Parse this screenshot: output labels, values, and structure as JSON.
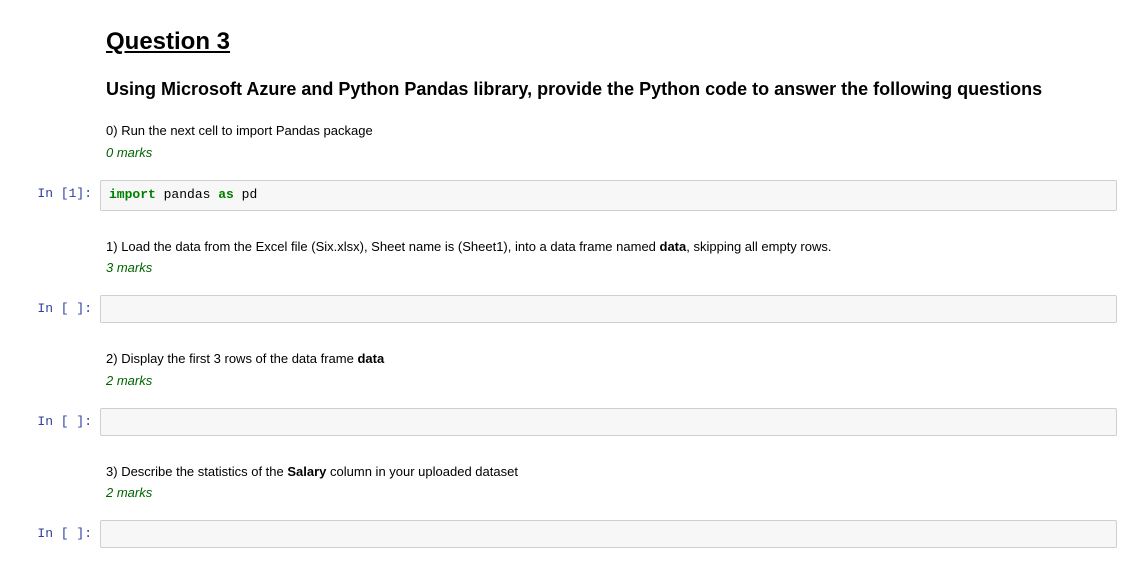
{
  "header": {
    "title": "Question 3",
    "subtitle": "Using Microsoft Azure and Python Pandas library, provide the Python code to answer the following questions"
  },
  "questions": [
    {
      "number": "0)",
      "text_before": "Run the next cell to import Pandas package",
      "bold": "",
      "text_after": "",
      "marks": "0 marks"
    },
    {
      "number": "1)",
      "text_before": "Load the data from the Excel file (Six.xlsx), Sheet name is (Sheet1), into a data frame named ",
      "bold": "data",
      "text_after": ", skipping all empty rows.",
      "marks": "3 marks"
    },
    {
      "number": "2)",
      "text_before": "Display the first 3 rows of the data frame ",
      "bold": "data",
      "text_after": "",
      "marks": "2 marks"
    },
    {
      "number": "3)",
      "text_before": "Describe the statistics of the ",
      "bold": "Salary",
      "text_after": " column in your uploaded dataset",
      "marks": "2 marks"
    }
  ],
  "cells": [
    {
      "prompt_label": "In [1]:",
      "kw1": "import",
      "plain": " pandas ",
      "kw2": "as",
      "plain2": " pd"
    },
    {
      "prompt_label": "In [ ]:",
      "code": ""
    },
    {
      "prompt_label": "In [ ]:",
      "code": ""
    },
    {
      "prompt_label": "In [ ]:",
      "code": ""
    }
  ]
}
